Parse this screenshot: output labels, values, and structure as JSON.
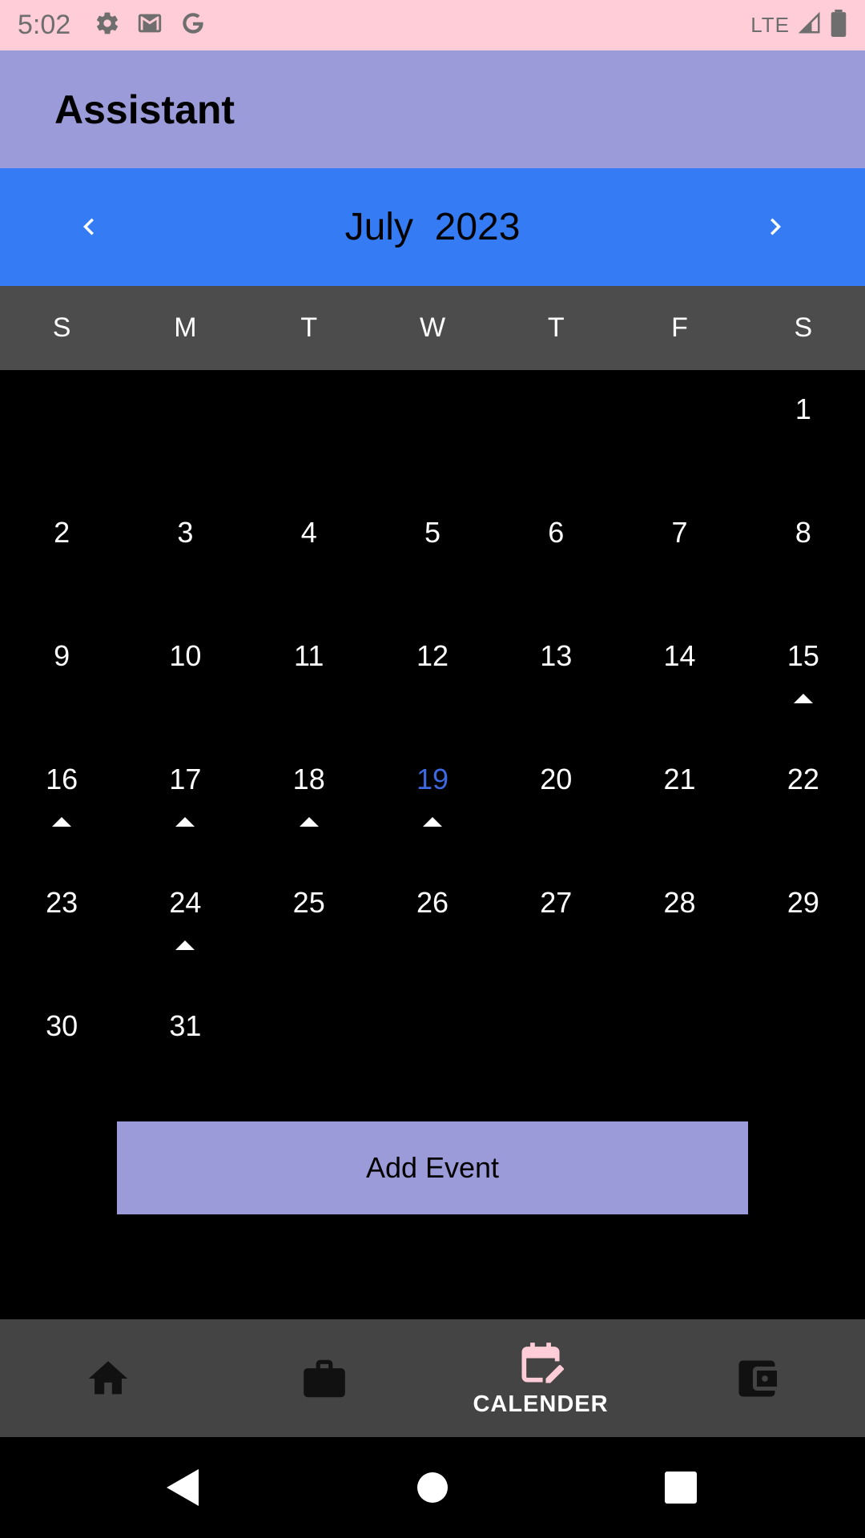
{
  "status_bar": {
    "time": "5:02",
    "network": "LTE"
  },
  "app_bar": {
    "title": "Assistant"
  },
  "calendar": {
    "month": "July",
    "year": "2023",
    "weekdays": [
      "S",
      "M",
      "T",
      "W",
      "T",
      "F",
      "S"
    ],
    "days": [
      {
        "d": "",
        "m": false
      },
      {
        "d": "",
        "m": false
      },
      {
        "d": "",
        "m": false
      },
      {
        "d": "",
        "m": false
      },
      {
        "d": "",
        "m": false
      },
      {
        "d": "",
        "m": false
      },
      {
        "d": "1",
        "m": false
      },
      {
        "d": "2",
        "m": false
      },
      {
        "d": "3",
        "m": false
      },
      {
        "d": "4",
        "m": false
      },
      {
        "d": "5",
        "m": false
      },
      {
        "d": "6",
        "m": false
      },
      {
        "d": "7",
        "m": false
      },
      {
        "d": "8",
        "m": false
      },
      {
        "d": "9",
        "m": false
      },
      {
        "d": "10",
        "m": false
      },
      {
        "d": "11",
        "m": false
      },
      {
        "d": "12",
        "m": false
      },
      {
        "d": "13",
        "m": false
      },
      {
        "d": "14",
        "m": false
      },
      {
        "d": "15",
        "m": true
      },
      {
        "d": "16",
        "m": true
      },
      {
        "d": "17",
        "m": true
      },
      {
        "d": "18",
        "m": true
      },
      {
        "d": "19",
        "m": true,
        "today": true
      },
      {
        "d": "20",
        "m": false
      },
      {
        "d": "21",
        "m": false
      },
      {
        "d": "22",
        "m": false
      },
      {
        "d": "23",
        "m": false
      },
      {
        "d": "24",
        "m": true
      },
      {
        "d": "25",
        "m": false
      },
      {
        "d": "26",
        "m": false
      },
      {
        "d": "27",
        "m": false
      },
      {
        "d": "28",
        "m": false
      },
      {
        "d": "29",
        "m": false
      },
      {
        "d": "30",
        "m": false
      },
      {
        "d": "31",
        "m": false
      },
      {
        "d": "",
        "m": false
      },
      {
        "d": "",
        "m": false
      },
      {
        "d": "",
        "m": false
      },
      {
        "d": "",
        "m": false
      },
      {
        "d": "",
        "m": false
      }
    ]
  },
  "add_event_label": "Add Event",
  "bottom_nav": {
    "items": [
      {
        "icon": "home-icon",
        "label": ""
      },
      {
        "icon": "briefcase-icon",
        "label": ""
      },
      {
        "icon": "calendar-edit-icon",
        "label": "CALENDER",
        "active": true
      },
      {
        "icon": "wallet-icon",
        "label": ""
      }
    ]
  },
  "colors": {
    "status_bar": "#ffcdd7",
    "app_bar": "#9b9bd9",
    "month_header": "#357cf4",
    "weekday_row": "#4c4c4c",
    "today": "#3d68e0",
    "active_nav_icon": "#ffcdd7",
    "bottom_nav": "#444444"
  }
}
